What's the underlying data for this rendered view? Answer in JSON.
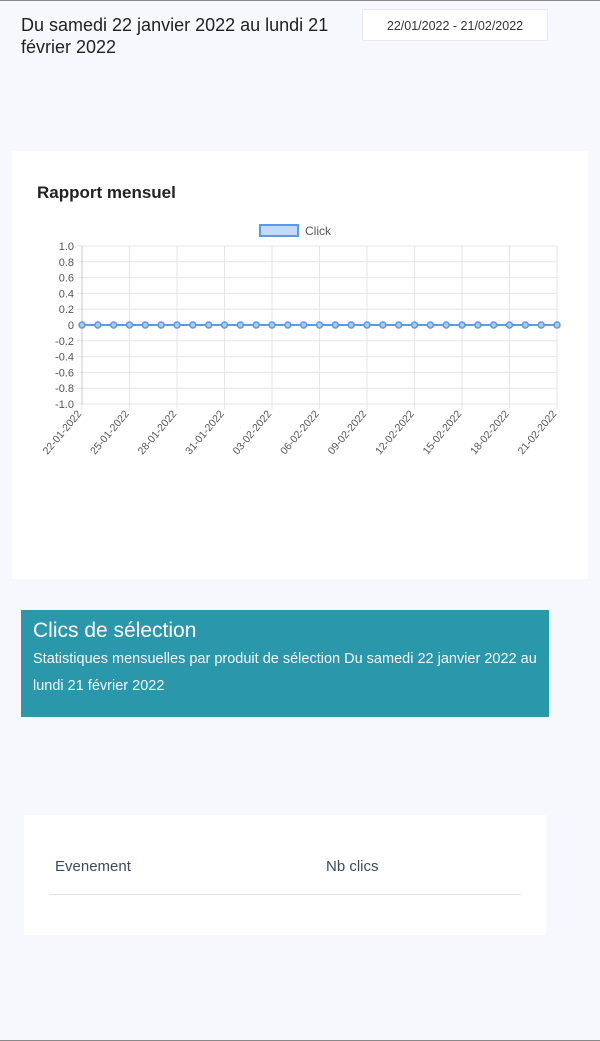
{
  "header": {
    "period_title": "Du samedi 22 janvier 2022 au lundi 21 février 2022",
    "date_range_value": "22/01/2022 - 21/02/2022"
  },
  "report": {
    "title": "Rapport mensuel"
  },
  "chart_data": {
    "type": "line",
    "legend": "top-center",
    "grid": true,
    "ylim": [
      -1.0,
      1.0
    ],
    "y_ticks": [
      "1.0",
      "0.8",
      "0.6",
      "0.4",
      "0.2",
      "0",
      "-0.2",
      "-0.4",
      "-0.6",
      "-0.8",
      "-1.0"
    ],
    "x_tick_labels": [
      "22-01-2022",
      "25-01-2022",
      "28-01-2022",
      "31-01-2022",
      "03-02-2022",
      "06-02-2022",
      "09-02-2022",
      "12-02-2022",
      "15-02-2022",
      "18-02-2022",
      "21-02-2022"
    ],
    "x": [
      "22-01-2022",
      "23-01-2022",
      "24-01-2022",
      "25-01-2022",
      "26-01-2022",
      "27-01-2022",
      "28-01-2022",
      "29-01-2022",
      "30-01-2022",
      "31-01-2022",
      "01-02-2022",
      "02-02-2022",
      "03-02-2022",
      "04-02-2022",
      "05-02-2022",
      "06-02-2022",
      "07-02-2022",
      "08-02-2022",
      "09-02-2022",
      "10-02-2022",
      "11-02-2022",
      "12-02-2022",
      "13-02-2022",
      "14-02-2022",
      "15-02-2022",
      "16-02-2022",
      "17-02-2022",
      "18-02-2022",
      "19-02-2022",
      "20-02-2022",
      "21-02-2022"
    ],
    "series": [
      {
        "name": "Click",
        "color": "#5b9ae6",
        "values": [
          0,
          0,
          0,
          0,
          0,
          0,
          0,
          0,
          0,
          0,
          0,
          0,
          0,
          0,
          0,
          0,
          0,
          0,
          0,
          0,
          0,
          0,
          0,
          0,
          0,
          0,
          0,
          0,
          0,
          0,
          0
        ]
      }
    ]
  },
  "selection": {
    "title": "Clics de sélection",
    "subtitle": "Statistiques mensuelles par produit de sélection Du samedi 22 janvier 2022 au lundi 21 février 2022",
    "color": "#2b97aa"
  },
  "table": {
    "columns": [
      "Evenement",
      "Nb clics"
    ],
    "rows": []
  }
}
